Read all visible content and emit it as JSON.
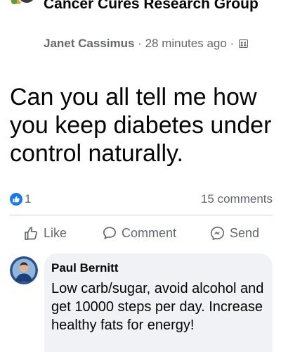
{
  "post": {
    "group_name": "Cancer Cures Research Group",
    "author": "Janet Cassimus",
    "separator": " · ",
    "time": "28 minutes ago",
    "dot": " ·",
    "audience_icon": "group-audience-icon",
    "text": "Can you all tell me how you keep diabetes under control naturally."
  },
  "stats": {
    "reaction_icon": "like-badge-icon",
    "reaction_count": "1",
    "comments": "15 comments"
  },
  "actions": {
    "like_label": "Like",
    "comment_label": "Comment",
    "send_label": "Send"
  },
  "comment": {
    "author": "Paul Bernitt",
    "text": "Low carb/sugar, avoid alcohol and get 10000 steps per day. Increase healthy fats for energy!"
  },
  "colors": {
    "like_blue": "#1877f2",
    "meta_gray": "#65676b",
    "bubble_bg": "#f0f2f5",
    "text": "#050505"
  }
}
